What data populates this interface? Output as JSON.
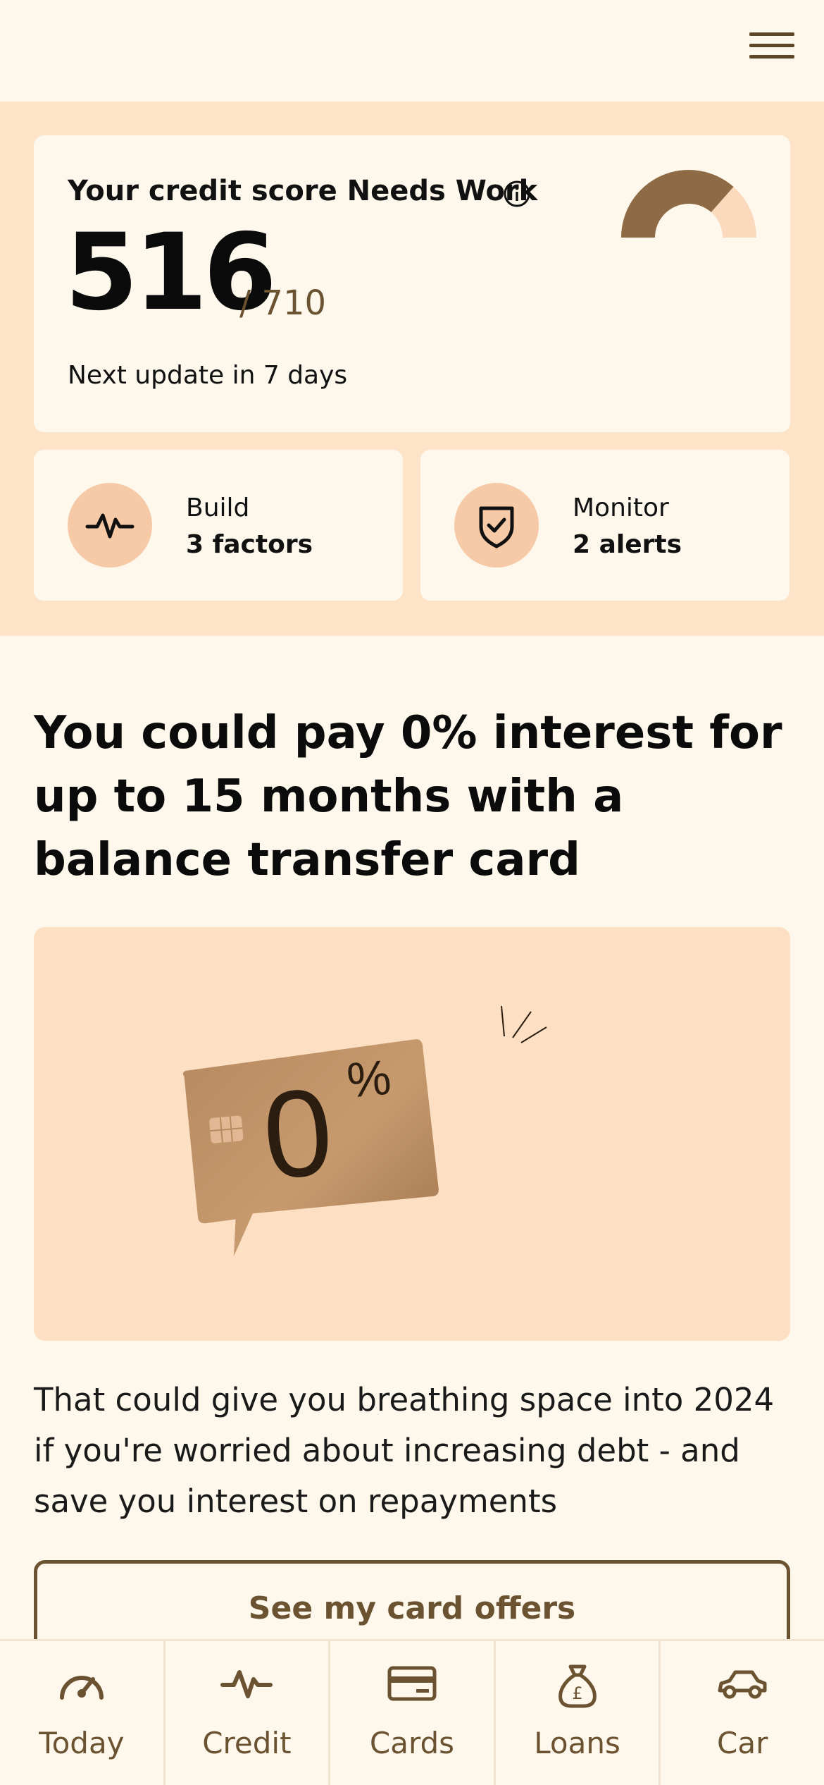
{
  "header": {
    "menu_icon": "hamburger-menu-icon"
  },
  "score": {
    "title": "Your credit score Needs Work",
    "value": "516",
    "max": "/ 710",
    "update": "Next update in 7 days",
    "info_icon": "info-icon",
    "gauge_fraction": 0.73,
    "colors": {
      "filled": "#8f6b45",
      "empty": "#fbd9bd"
    }
  },
  "tiles": [
    {
      "label": "Build",
      "value": "3 factors",
      "icon": "pulse-icon"
    },
    {
      "label": "Monitor",
      "value": "2 alerts",
      "icon": "shield-check-icon"
    }
  ],
  "promo": {
    "headline": "You could pay 0% interest for up to 15 months with a balance transfer card",
    "image_text": "0",
    "image_percent": "%",
    "body": "That could give you breathing space into 2024 if you're worried about increasing debt - and save you interest on repayments",
    "cta": "See my card offers"
  },
  "nav": [
    {
      "label": "Today",
      "icon": "speedometer-icon"
    },
    {
      "label": "Credit",
      "icon": "pulse-icon"
    },
    {
      "label": "Cards",
      "icon": "credit-card-icon"
    },
    {
      "label": "Loans",
      "icon": "money-bag-icon"
    },
    {
      "label": "Car",
      "icon": "car-icon"
    }
  ],
  "colors": {
    "background": "#fdf7ec",
    "band": "#fde3c8",
    "accent": "#6b5231",
    "promo_bg": "#fde0c3"
  }
}
